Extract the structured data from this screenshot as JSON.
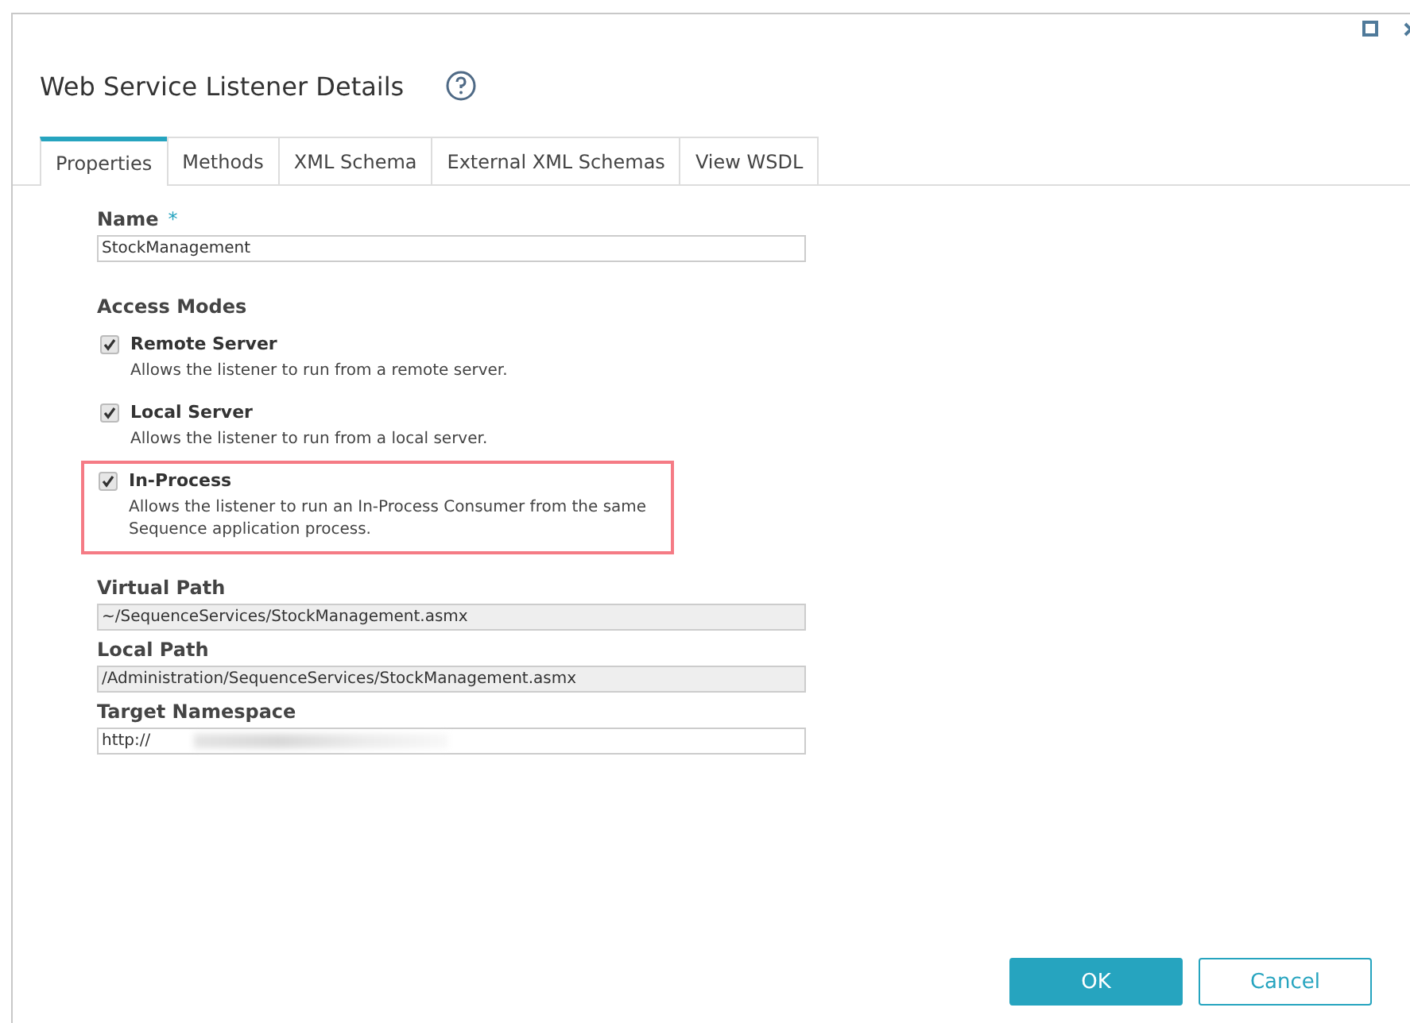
{
  "window": {
    "title": "Web Service Listener Details",
    "controls": [
      {
        "kind": "maximize"
      },
      {
        "kind": "close"
      }
    ]
  },
  "tabs": [
    {
      "label": "Properties",
      "selected": true
    },
    {
      "label": "Methods",
      "selected": false
    },
    {
      "label": "XML Schema",
      "selected": false
    },
    {
      "label": "External XML Schemas",
      "selected": false
    },
    {
      "label": "View WSDL",
      "selected": false
    }
  ],
  "name_field": {
    "label": "Name",
    "required_mark": "*",
    "value": "StockManagement"
  },
  "access_modes": {
    "heading": "Access Modes",
    "items": [
      {
        "label": "Remote Server",
        "description": "Allows the listener to run from a remote server.",
        "checked": true,
        "highlighted": false
      },
      {
        "label": "Local Server",
        "description": "Allows the listener to run from a local server.",
        "checked": true,
        "highlighted": false
      },
      {
        "label": "In-Process",
        "description": "Allows the listener to run an In-Process Consumer from the same Sequence application process.",
        "checked": true,
        "highlighted": true
      }
    ]
  },
  "paths": [
    {
      "label": "Virtual Path",
      "value": "~/SequenceServices/StockManagement.asmx",
      "disabled": true,
      "redacted": false
    },
    {
      "label": "Local Path",
      "value": "/Administration/SequenceServices/StockManagement.asmx",
      "disabled": true,
      "redacted": false
    },
    {
      "label": "Target Namespace",
      "value": "http://",
      "disabled": false,
      "redacted": true
    }
  ],
  "buttons": [
    {
      "label": "OK",
      "kind": "primary"
    },
    {
      "label": "Cancel",
      "kind": "secondary"
    }
  ]
}
